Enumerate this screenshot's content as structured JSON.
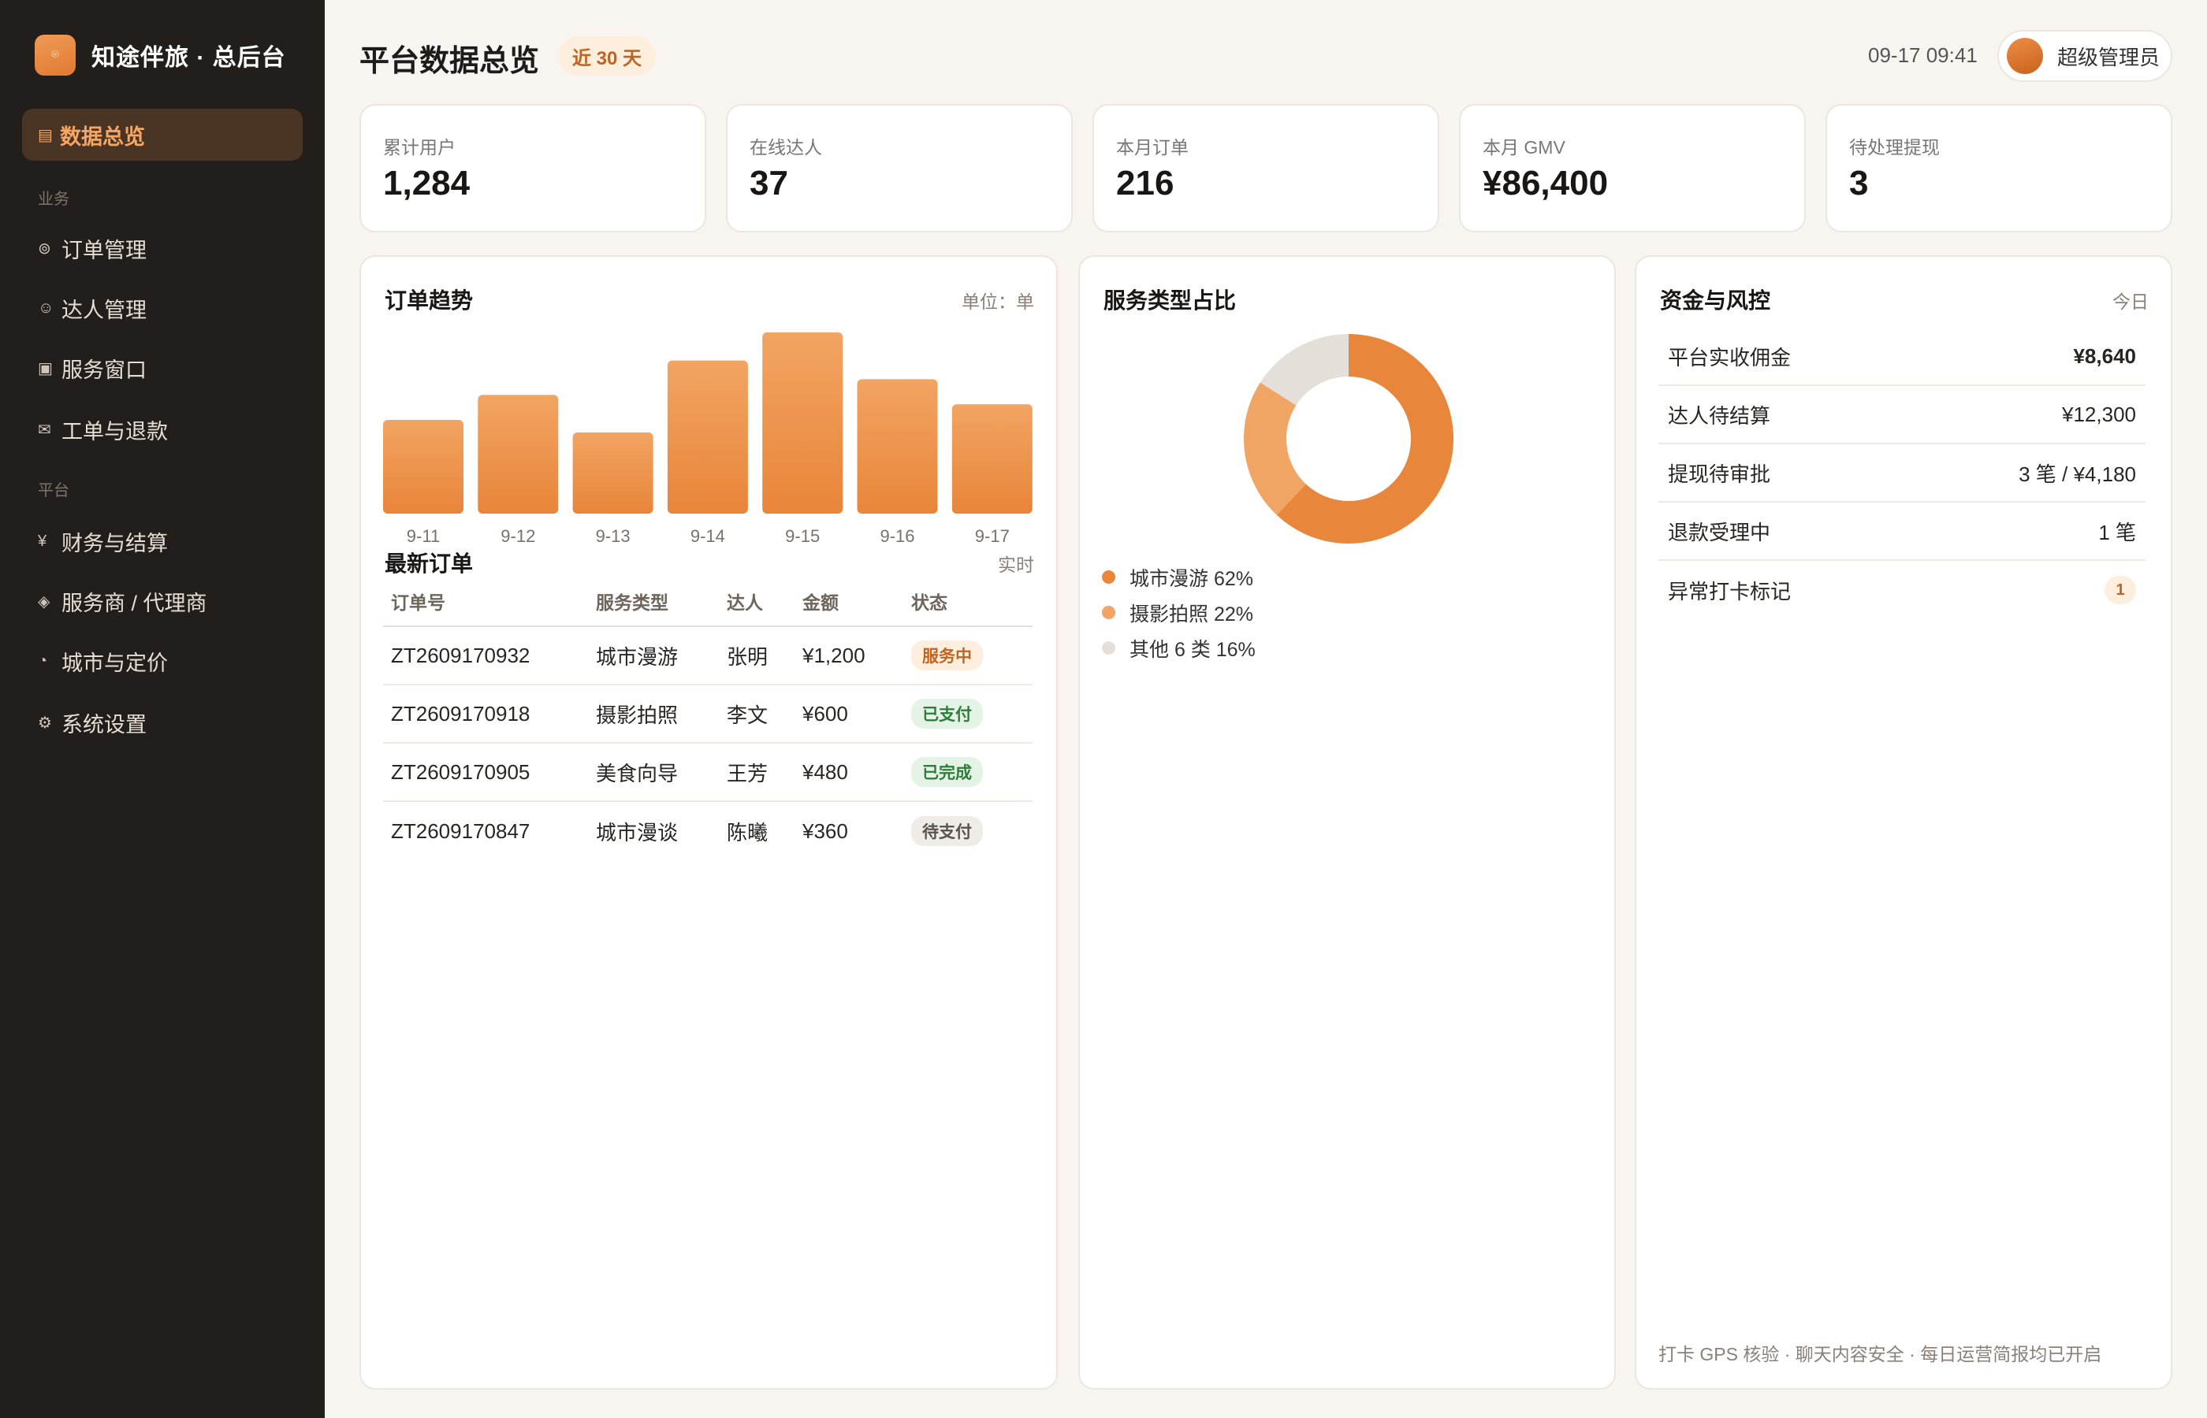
{
  "app": {
    "brand_logo_icon": "compass-icon",
    "brand_logo_glyph": "⌾",
    "brand_title": "知途伴旅 · 总后台"
  },
  "sidebar": {
    "active_item": {
      "label": "数据总览",
      "icon": "grid-icon",
      "glyph": "▤"
    },
    "sections": [
      {
        "title": "业务",
        "items": [
          {
            "label": "订单管理",
            "icon": "order-icon",
            "glyph": "⊚"
          },
          {
            "label": "达人管理",
            "icon": "smile-icon",
            "glyph": "☺"
          },
          {
            "label": "服务窗口",
            "icon": "window-icon",
            "glyph": "▣"
          },
          {
            "label": "工单与退款",
            "icon": "mail-icon",
            "glyph": "✉"
          }
        ]
      },
      {
        "title": "平台",
        "items": [
          {
            "label": "财务与结算",
            "icon": "yen-icon",
            "glyph": "¥"
          },
          {
            "label": "服务商 / 代理商",
            "icon": "diamond-icon",
            "glyph": "◈"
          },
          {
            "label": "城市与定价",
            "icon": "pie-icon",
            "glyph": "◔"
          },
          {
            "label": "系统设置",
            "icon": "gear-icon",
            "glyph": "⚙"
          }
        ]
      }
    ]
  },
  "header": {
    "title": "平台数据总览",
    "range_badge": "近 30 天",
    "datetime": "09-17 09:41",
    "user_name": "超级管理员"
  },
  "kpis": [
    {
      "label": "累计用户",
      "value": "1,284"
    },
    {
      "label": "在线达人",
      "value": "37"
    },
    {
      "label": "本月订单",
      "value": "216"
    },
    {
      "label": "本月 GMV",
      "value": "¥86,400"
    },
    {
      "label": "待处理提现",
      "value": "3"
    }
  ],
  "trend_panel": {
    "title": "订单趋势",
    "unit": "单位：单"
  },
  "chart_data": [
    {
      "type": "bar",
      "title": "订单趋势",
      "categories": [
        "9-11",
        "9-12",
        "9-13",
        "9-14",
        "9-15",
        "9-16",
        "9-17"
      ],
      "values": [
        30,
        38,
        26,
        49,
        58,
        43,
        35
      ],
      "ylim": [
        0,
        62
      ],
      "grid": false,
      "color": "#ea8a42"
    },
    {
      "type": "pie",
      "title": "服务类型占比",
      "donut": true,
      "slices": [
        {
          "label": "城市漫游",
          "value": 62,
          "color": "#e8863c"
        },
        {
          "label": "摄影拍照",
          "value": 22,
          "color": "#f0a564"
        },
        {
          "label": "其他 6 类",
          "value": 16,
          "color": "#e4dfd9"
        }
      ]
    }
  ],
  "orders": {
    "title": "最新订单",
    "note": "实时",
    "columns": [
      "订单号",
      "服务类型",
      "达人",
      "金额",
      "状态"
    ],
    "rows": [
      {
        "id": "ZT2609170932",
        "type": "城市漫游",
        "guide": "张明",
        "amount": "¥1,200",
        "status": "服务中",
        "status_bg": "#fdeedd",
        "status_fg": "#c06420"
      },
      {
        "id": "ZT2609170918",
        "type": "摄影拍照",
        "guide": "李文",
        "amount": "¥600",
        "status": "已支付",
        "status_bg": "#e4f3e6",
        "status_fg": "#2e7d3a"
      },
      {
        "id": "ZT2609170905",
        "type": "美食向导",
        "guide": "王芳",
        "amount": "¥480",
        "status": "已完成",
        "status_bg": "#e4f3e6",
        "status_fg": "#2e7d3a"
      },
      {
        "id": "ZT2609170847",
        "type": "城市漫谈",
        "guide": "陈曦",
        "amount": "¥360",
        "status": "待支付",
        "status_bg": "#efebe7",
        "status_fg": "#5a524c"
      }
    ]
  },
  "service_panel": {
    "title": "服务类型占比",
    "legend": [
      "城市漫游 62%",
      "摄影拍照 22%",
      "其他 6 类 16%"
    ]
  },
  "finance_panel": {
    "title": "资金与风控",
    "note": "今日",
    "rows": [
      {
        "label": "平台实收佣金",
        "value": "¥8,640"
      },
      {
        "label": "达人待结算",
        "value": "¥12,300"
      },
      {
        "label": "提现待审批",
        "value": "3 笔 / ¥4,180"
      },
      {
        "label": "退款受理中",
        "value": "1 笔"
      },
      {
        "label": "异常打卡标记",
        "value": "1"
      }
    ],
    "footer": "打卡 GPS 核验 · 聊天内容安全 · 每日运营简报均已开启"
  }
}
